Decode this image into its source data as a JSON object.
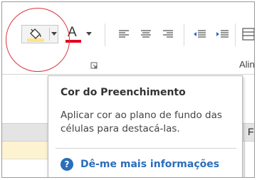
{
  "ribbon": {
    "fill_button": {
      "icon": "paint-bucket-icon",
      "color": "#ffe38c"
    },
    "font_color_button": {
      "letter": "A",
      "icon": "font-color-icon",
      "color": "#e2001a"
    },
    "dialog_launcher_icon": "launcher-icon",
    "alignment_group_label": "Alin"
  },
  "sheet": {
    "column_label": "F",
    "highlight_color": "#fdf3d0"
  },
  "tooltip": {
    "title": "Cor do Preenchimento",
    "description": "Aplicar cor ao plano de fundo das células para destacá-las.",
    "help_icon": "?",
    "help_link": "Dê-me mais informações"
  },
  "annotation": {
    "circle_color": "#d9363e"
  }
}
